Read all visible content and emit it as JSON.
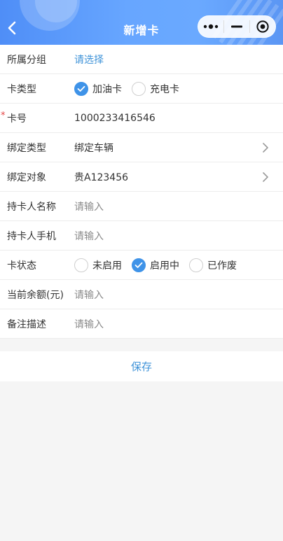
{
  "header": {
    "title": "新增卡",
    "back_icon": "chevron-left-icon",
    "more_icon": "more-dots-icon",
    "minimize_icon": "minimize-icon",
    "close_icon": "target-circle-icon",
    "gradient_start": "#4f8ef7",
    "gradient_end": "#6aa9ff"
  },
  "form": {
    "group": {
      "label": "所属分组",
      "value": "请选择"
    },
    "card_type": {
      "label": "卡类型",
      "options": [
        {
          "label": "加油卡",
          "checked": true
        },
        {
          "label": "充电卡",
          "checked": false
        }
      ]
    },
    "card_no": {
      "required_mark": "*",
      "label": "卡号",
      "value": "1000233416546"
    },
    "bind_type": {
      "label": "绑定类型",
      "value": "绑定车辆"
    },
    "bind_target": {
      "label": "绑定对象",
      "value": "贵A123456"
    },
    "holder_name": {
      "label": "持卡人名称",
      "placeholder": "请输入"
    },
    "holder_phone": {
      "label": "持卡人手机",
      "placeholder": "请输入"
    },
    "card_status": {
      "label": "卡状态",
      "options": [
        {
          "label": "未启用",
          "checked": false
        },
        {
          "label": "启用中",
          "checked": true
        },
        {
          "label": "已作废",
          "checked": false
        }
      ]
    },
    "balance": {
      "label": "当前余额(元)",
      "placeholder": "请输入"
    },
    "remark": {
      "label": "备注描述",
      "placeholder": "请输入"
    }
  },
  "actions": {
    "save_label": "保存"
  },
  "colors": {
    "accent": "#3f93e8",
    "link": "#3f93d8",
    "required": "#e54545"
  }
}
